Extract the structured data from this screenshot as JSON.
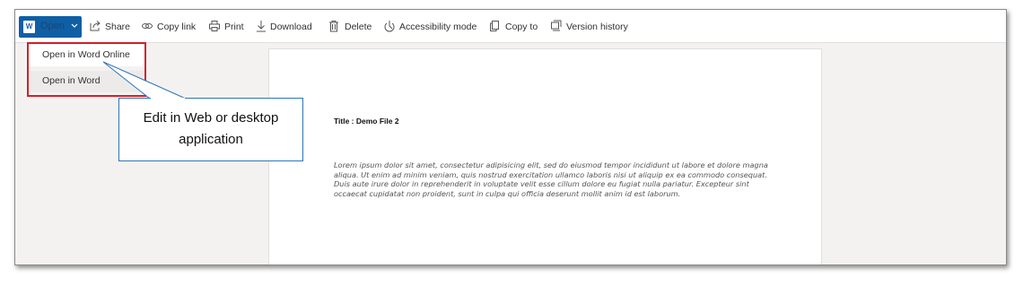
{
  "toolbar": {
    "open_label": "Open",
    "open_app_icon": "word-logo-icon",
    "items": [
      {
        "label": "Share",
        "icon": "share-icon"
      },
      {
        "label": "Copy link",
        "icon": "link-icon"
      },
      {
        "label": "Print",
        "icon": "print-icon"
      },
      {
        "label": "Download",
        "icon": "download-icon"
      },
      {
        "label": "Delete",
        "icon": "trash-icon"
      },
      {
        "label": "Accessibility mode",
        "icon": "accessibility-icon"
      },
      {
        "label": "Copy to",
        "icon": "copy-icon"
      },
      {
        "label": "Version history",
        "icon": "history-icon"
      }
    ]
  },
  "dropdown": {
    "items": [
      {
        "label": "Open in Word Online"
      },
      {
        "label": "Open in Word"
      }
    ],
    "highlight_color": "#d3202a"
  },
  "document": {
    "title": "Title : Demo File 2",
    "body": "Lorem ipsum dolor sit amet, consectetur adipisicing elit, sed do eiusmod tempor incididunt ut labore et dolore magna aliqua. Ut enim ad minim veniam, quis nostrud exercitation ullamco laboris nisi ut aliquip ex ea commodo consequat. Duis aute irure dolor in reprehenderit in voluptate velit esse cillum dolore eu fugiat nulla pariatur. Excepteur sint occaecat cupidatat non proident, sunt in culpa qui officia deserunt mollit anim id est laborum."
  },
  "annotation": {
    "text_line1": "Edit in Web or desktop",
    "text_line2": "application",
    "border_color": "#2e74b5"
  },
  "colors": {
    "accent": "#0f5fa5",
    "background": "#f3f2f1"
  }
}
